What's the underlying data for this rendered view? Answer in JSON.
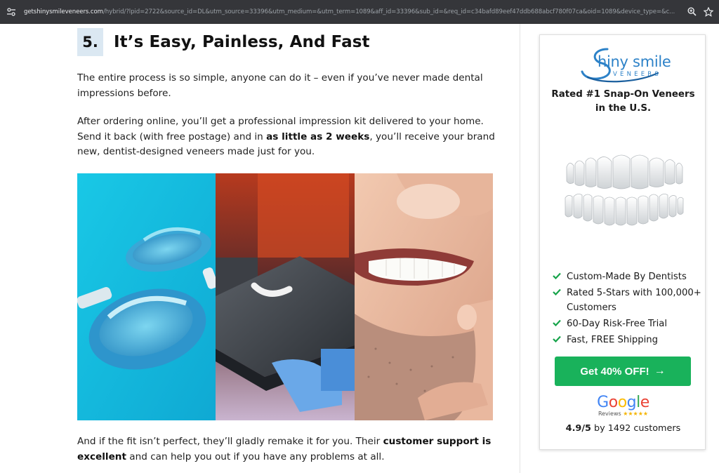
{
  "browser": {
    "url_domain": "getshinysmileveneers.com",
    "url_rest": "/hybrid/?lpid=2722&source_id=DL&utm_source=33396&utm_medium=&utm_term=1089&aff_id=33396&sub_id=&req_id=c34bafd89eef47ddb688abcf780f07ca&oid=1089&device_type=&c...",
    "icons": [
      "tune-icon",
      "zoom-icon",
      "star-icon"
    ]
  },
  "article": {
    "section_number": "5.",
    "section_title": "It’s Easy, Painless, And Fast",
    "p1": "The entire process is so simple, anyone can do it – even if you’ve never made dental impressions before.",
    "p2_a": "After ordering online, you’ll get a professional impression kit delivered to your home. Send it back (with free postage) and in ",
    "p2_bold": "as little as 2 weeks",
    "p2_b": ", you’ll receive your brand new, dentist-designed veneers made just for you.",
    "p3_a": "And if the fit isn’t perfect, they’ll gladly remake it for you. Their ",
    "p3_bold": "customer support is excellent",
    "p3_b": " and can help you out if you have any problems at all.",
    "images": [
      "dental-impression-trays-image",
      "3d-printed-veneers-image",
      "smiling-man-image"
    ]
  },
  "sidebar": {
    "logo_text": "hiny smile",
    "logo_sub": "VENEERS",
    "rated_line1": "Rated #1 Snap-On Veneers",
    "rated_line2": "in the U.S.",
    "features": [
      "Custom-Made By Dentists",
      "Rated 5-Stars with 100,000+ Customers",
      "60-Day Risk-Free Trial",
      "Fast, FREE Shipping"
    ],
    "cta_label": "Get 40% OFF!",
    "cta_arrow": "→",
    "google_word": [
      "G",
      "o",
      "o",
      "g",
      "l",
      "e"
    ],
    "google_colors": [
      "#4285f4",
      "#ea4335",
      "#fbbc05",
      "#4285f4",
      "#34a853",
      "#ea4335"
    ],
    "google_reviews": "Reviews",
    "google_stars": "★★★★★",
    "rating_value": "4.9/5",
    "rating_text": " by 1492 customers",
    "accent": "#19b25b",
    "brand_blue": "#2d82c8"
  }
}
